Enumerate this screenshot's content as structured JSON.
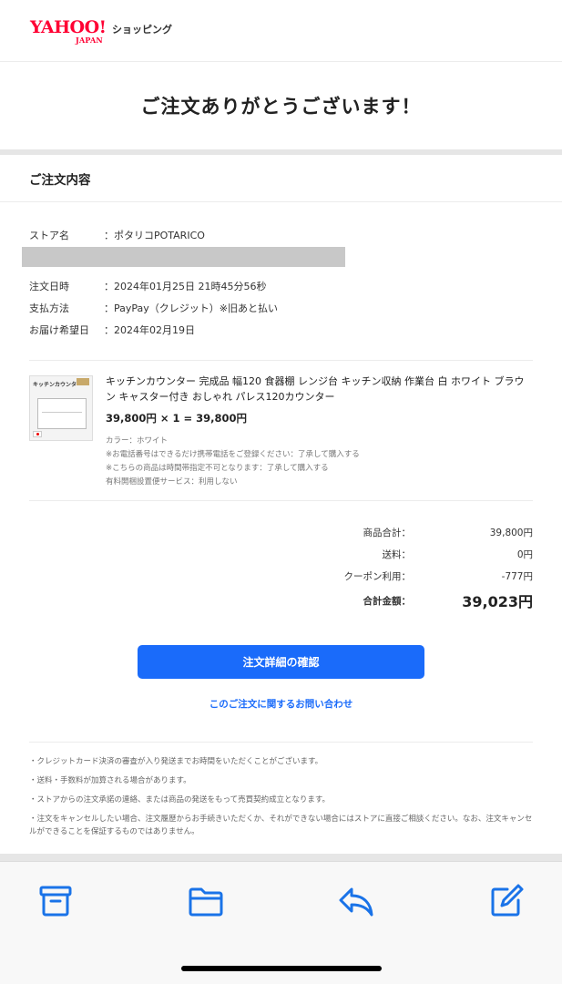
{
  "header": {
    "logo_main": "YAHOO!",
    "logo_sub": "JAPAN",
    "logo_shop": "ショッピング"
  },
  "thanks_title": "ご注文ありがとうございます！",
  "order": {
    "section_title": "ご注文内容",
    "store_label": "ストア名",
    "store_value": "：ポタリコPOTARICO",
    "date_label": "注文日時",
    "date_value": "：2024年01月25日 21時45分56秒",
    "payment_label": "支払方法",
    "payment_value": "：PayPay（クレジット）※旧あと払い",
    "delivery_label": "お届け希望日",
    "delivery_value": "：2024年02月19日"
  },
  "item": {
    "thumb_banner": "キッチンカウンター",
    "name": "キッチンカウンター 完成品 幅120 食器棚 レンジ台 キッチン収納 作業台 白 ホワイト ブラウン キャスター付き おしゃれ パレス120カウンター",
    "price_line": "39,800円 × 1 = 39,800円",
    "options": [
      "カラー：ホワイト",
      "※お電話番号はできるだけ携帯電話をご登録ください：了承して購入する",
      "※こちらの商品は時間帯指定不可となります：了承して購入する",
      "有料開梱設置便サービス：利用しない"
    ]
  },
  "totals": {
    "subtotal_label": "商品合計：",
    "subtotal_value": "39,800円",
    "shipping_label": "送料：",
    "shipping_value": "0円",
    "coupon_label": "クーポン利用：",
    "coupon_value": "-777円",
    "total_label": "合計金額：",
    "total_value": "39,023円"
  },
  "actions": {
    "detail_button": "注文詳細の確認",
    "contact_link": "このご注文に関するお問い合わせ"
  },
  "notes": [
    "・クレジットカード決済の審査が入り発送までお時間をいただくことがございます。",
    "・送料・手数料が加算される場合があります。",
    "・ストアからの注文承諾の連絡、または商品の発送をもって売買契約成立となります。",
    "・注文をキャンセルしたい場合、注文履歴からお手続きいただくか、それができない場合にはストアに直接ご相談ください。なお、注文キャンセルができることを保証するものではありません。"
  ],
  "toolbar": {
    "icons": [
      "archive-icon",
      "folder-icon",
      "reply-icon",
      "compose-icon"
    ]
  },
  "colors": {
    "brand_red": "#ff0033",
    "accent_blue": "#1a6bfa",
    "toolbar_icon_blue": "#1a73e8"
  }
}
